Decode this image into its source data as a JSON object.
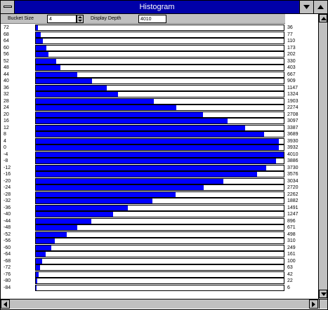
{
  "window": {
    "title": "Histogram"
  },
  "toolbar": {
    "bucket_size_label": "Bucket Size",
    "bucket_size_value": "4",
    "display_depth_label": "Display Depth",
    "display_depth_value": "4010"
  },
  "colors": {
    "bar_fill": "#0000ff",
    "titlebar": "#0000a8"
  },
  "histogram": {
    "max_count": 4010,
    "rows": [
      {
        "bucket": "72",
        "count": "36"
      },
      {
        "bucket": "68",
        "count": "77"
      },
      {
        "bucket": "64",
        "count": "110"
      },
      {
        "bucket": "60",
        "count": "173"
      },
      {
        "bucket": "56",
        "count": "202"
      },
      {
        "bucket": "52",
        "count": "330"
      },
      {
        "bucket": "48",
        "count": "403"
      },
      {
        "bucket": "44",
        "count": "667"
      },
      {
        "bucket": "40",
        "count": "909"
      },
      {
        "bucket": "36",
        "count": "1147"
      },
      {
        "bucket": "32",
        "count": "1324"
      },
      {
        "bucket": "28",
        "count": "1903"
      },
      {
        "bucket": "24",
        "count": "2274"
      },
      {
        "bucket": "20",
        "count": "2708"
      },
      {
        "bucket": "16",
        "count": "3097"
      },
      {
        "bucket": "12",
        "count": "3387"
      },
      {
        "bucket": "8",
        "count": "3689"
      },
      {
        "bucket": "4",
        "count": "3930"
      },
      {
        "bucket": "0",
        "count": "3932"
      },
      {
        "bucket": "-4",
        "count": "4010"
      },
      {
        "bucket": "-8",
        "count": "3886"
      },
      {
        "bucket": "-12",
        "count": "3730"
      },
      {
        "bucket": "-16",
        "count": "3576"
      },
      {
        "bucket": "-20",
        "count": "3034"
      },
      {
        "bucket": "-24",
        "count": "2720"
      },
      {
        "bucket": "-28",
        "count": "2262"
      },
      {
        "bucket": "-32",
        "count": "1882"
      },
      {
        "bucket": "-36",
        "count": "1491"
      },
      {
        "bucket": "-40",
        "count": "1247"
      },
      {
        "bucket": "-44",
        "count": "896"
      },
      {
        "bucket": "-48",
        "count": "671"
      },
      {
        "bucket": "-52",
        "count": "498"
      },
      {
        "bucket": "-56",
        "count": "310"
      },
      {
        "bucket": "-60",
        "count": "249"
      },
      {
        "bucket": "-64",
        "count": "161"
      },
      {
        "bucket": "-68",
        "count": "100"
      },
      {
        "bucket": "-72",
        "count": "63"
      },
      {
        "bucket": "-76",
        "count": "42"
      },
      {
        "bucket": "-80",
        "count": "22"
      },
      {
        "bucket": "-84",
        "count": "6"
      }
    ]
  }
}
